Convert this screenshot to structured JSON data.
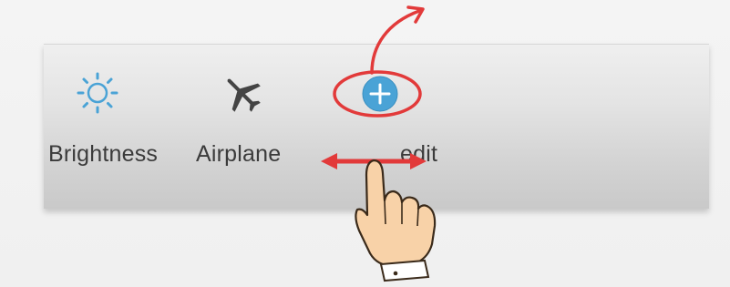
{
  "quick_settings": {
    "tiles": [
      {
        "id": "brightness",
        "label": "Brightness",
        "icon": "sun-icon"
      },
      {
        "id": "airplane",
        "label": "Airplane",
        "icon": "airplane-icon"
      },
      {
        "id": "edit",
        "label": "edit",
        "icon": "plus-circle-icon"
      }
    ]
  },
  "colors": {
    "accent_blue": "#4aa3d6",
    "annotation_red": "#e23a3a",
    "icon_dark": "#444444",
    "label_text": "#3b3b3b"
  },
  "annotations": {
    "highlight": "red-ellipse-around-edit",
    "gesture": "drag-left-right",
    "arrow": "curved-arrow-up"
  }
}
